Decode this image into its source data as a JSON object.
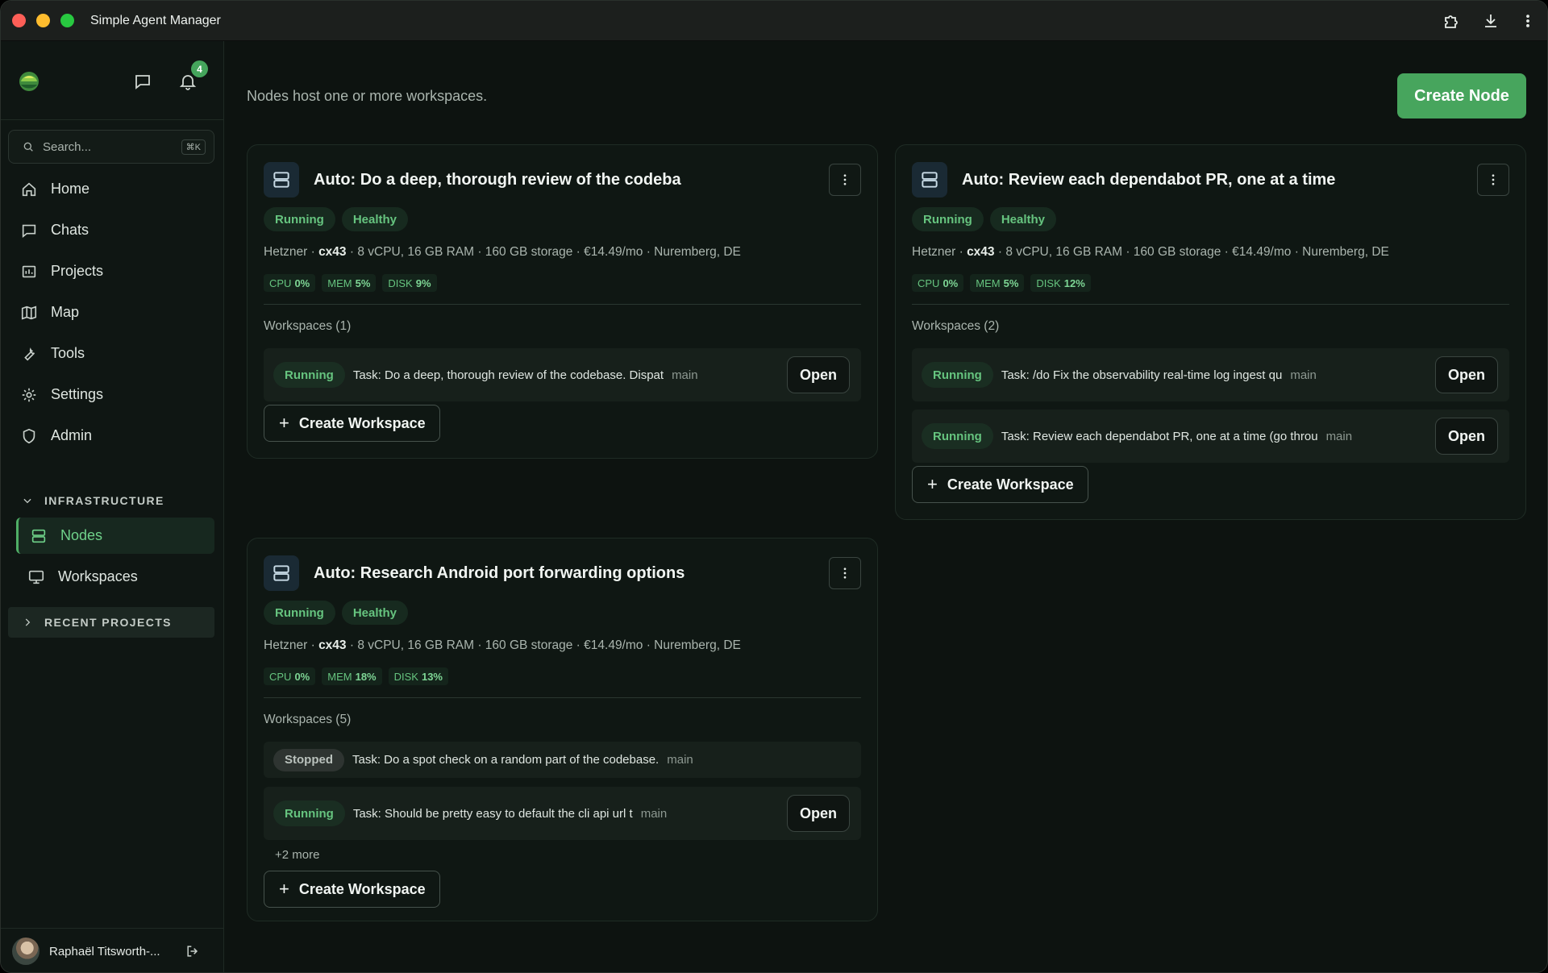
{
  "app": {
    "title": "Simple Agent Manager"
  },
  "sidebar": {
    "notification_count": "4",
    "search_placeholder": "Search...",
    "search_shortcut": "⌘K",
    "nav": [
      {
        "label": "Home",
        "icon": "home-icon"
      },
      {
        "label": "Chats",
        "icon": "chat-icon"
      },
      {
        "label": "Projects",
        "icon": "projects-icon"
      },
      {
        "label": "Map",
        "icon": "map-icon"
      },
      {
        "label": "Tools",
        "icon": "wrench-icon"
      },
      {
        "label": "Settings",
        "icon": "gear-icon"
      },
      {
        "label": "Admin",
        "icon": "shield-icon"
      }
    ],
    "infrastructure": {
      "header": "INFRASTRUCTURE",
      "items": [
        {
          "label": "Nodes",
          "active": true
        },
        {
          "label": "Workspaces"
        }
      ]
    },
    "recent_projects": "RECENT PROJECTS",
    "user_name": "Raphaël Titsworth-..."
  },
  "main": {
    "subtitle": "Nodes host one or more workspaces.",
    "create_node_label": "Create Node",
    "create_workspace_label": "Create Workspace",
    "open_label": "Open",
    "nodes": [
      {
        "title": "Auto: Do a deep, thorough review of the codeba",
        "status": "Running",
        "health": "Healthy",
        "provider": "Hetzner",
        "instance": "cx43",
        "spec": "8 vCPU, 16 GB RAM · 160 GB storage · €14.49/mo · Nuremberg, DE",
        "cpu": "0%",
        "mem": "5%",
        "disk": "9%",
        "workspaces_label": "Workspaces (1)",
        "workspaces": [
          {
            "status": "Running",
            "task": "Task: Do a deep, thorough review of the codebase. Dispat",
            "branch": "main"
          }
        ]
      },
      {
        "title": "Auto: Review each dependabot PR, one at a time",
        "status": "Running",
        "health": "Healthy",
        "provider": "Hetzner",
        "instance": "cx43",
        "spec": "8 vCPU, 16 GB RAM · 160 GB storage · €14.49/mo · Nuremberg, DE",
        "cpu": "0%",
        "mem": "5%",
        "disk": "12%",
        "workspaces_label": "Workspaces (2)",
        "workspaces": [
          {
            "status": "Running",
            "task": "Task: /do Fix the observability real-time log ingest qu",
            "branch": "main"
          },
          {
            "status": "Running",
            "task": "Task: Review each dependabot PR, one at a time (go throu",
            "branch": "main"
          }
        ]
      },
      {
        "title": "Auto: Research Android port forwarding options",
        "status": "Running",
        "health": "Healthy",
        "provider": "Hetzner",
        "instance": "cx43",
        "spec": "8 vCPU, 16 GB RAM · 160 GB storage · €14.49/mo · Nuremberg, DE",
        "cpu": "0%",
        "mem": "18%",
        "disk": "13%",
        "workspaces_label": "Workspaces (5)",
        "workspaces": [
          {
            "status": "Stopped",
            "task": "Task: Do a spot check on a random part of the codebase.",
            "branch": "main"
          },
          {
            "status": "Running",
            "task": "Task: Should be pretty easy to default the cli api url t",
            "branch": "main"
          }
        ],
        "more_label": "+2 more"
      }
    ]
  },
  "metric_labels": {
    "cpu": "CPU",
    "mem": "MEM",
    "disk": "DISK"
  },
  "colors": {
    "accent": "#47a55d",
    "running": "#66c47f",
    "background": "#0d1310"
  }
}
